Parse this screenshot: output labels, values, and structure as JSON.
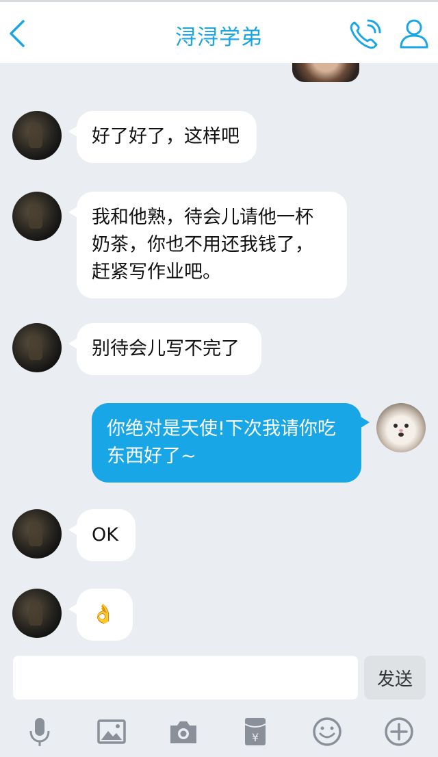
{
  "header": {
    "title": "浔浔学弟",
    "back_icon": "chevron-left-icon",
    "call_icon": "phone-icon",
    "profile_icon": "person-icon",
    "accent_color": "#19a6e6"
  },
  "messages": [
    {
      "direction": "in",
      "text": "好了好了，这样吧"
    },
    {
      "direction": "in",
      "lines": [
        "我和他熟，待会儿请他一杯",
        "奶茶，你也不用还我钱了，",
        "赶紧写作业吧。"
      ]
    },
    {
      "direction": "in",
      "text": "别待会儿写不完了"
    },
    {
      "direction": "out",
      "lines": [
        "你绝对是天使!下次我请你吃",
        "东西好了~"
      ]
    },
    {
      "direction": "in",
      "text": "OK"
    },
    {
      "direction": "in",
      "text": "👌"
    }
  ],
  "composer": {
    "input_value": "",
    "send_label": "发送"
  },
  "toolbar": {
    "icons": [
      "microphone-icon",
      "image-icon",
      "camera-icon",
      "red-packet-icon",
      "emoji-icon",
      "plus-icon"
    ]
  }
}
